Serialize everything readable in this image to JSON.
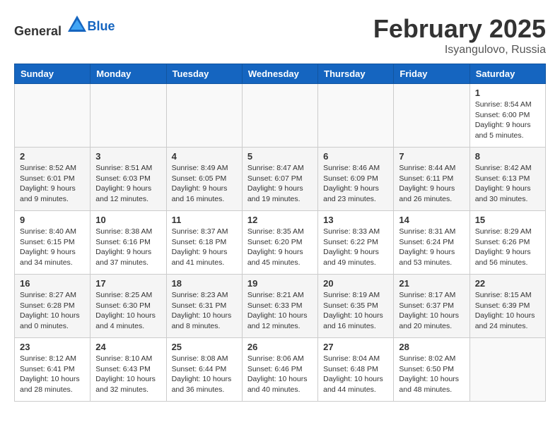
{
  "header": {
    "logo_general": "General",
    "logo_blue": "Blue",
    "month_year": "February 2025",
    "location": "Isyangulovo, Russia"
  },
  "weekdays": [
    "Sunday",
    "Monday",
    "Tuesday",
    "Wednesday",
    "Thursday",
    "Friday",
    "Saturday"
  ],
  "weeks": [
    [
      {
        "day": "",
        "info": ""
      },
      {
        "day": "",
        "info": ""
      },
      {
        "day": "",
        "info": ""
      },
      {
        "day": "",
        "info": ""
      },
      {
        "day": "",
        "info": ""
      },
      {
        "day": "",
        "info": ""
      },
      {
        "day": "1",
        "info": "Sunrise: 8:54 AM\nSunset: 6:00 PM\nDaylight: 9 hours and 5 minutes."
      }
    ],
    [
      {
        "day": "2",
        "info": "Sunrise: 8:52 AM\nSunset: 6:01 PM\nDaylight: 9 hours and 9 minutes."
      },
      {
        "day": "3",
        "info": "Sunrise: 8:51 AM\nSunset: 6:03 PM\nDaylight: 9 hours and 12 minutes."
      },
      {
        "day": "4",
        "info": "Sunrise: 8:49 AM\nSunset: 6:05 PM\nDaylight: 9 hours and 16 minutes."
      },
      {
        "day": "5",
        "info": "Sunrise: 8:47 AM\nSunset: 6:07 PM\nDaylight: 9 hours and 19 minutes."
      },
      {
        "day": "6",
        "info": "Sunrise: 8:46 AM\nSunset: 6:09 PM\nDaylight: 9 hours and 23 minutes."
      },
      {
        "day": "7",
        "info": "Sunrise: 8:44 AM\nSunset: 6:11 PM\nDaylight: 9 hours and 26 minutes."
      },
      {
        "day": "8",
        "info": "Sunrise: 8:42 AM\nSunset: 6:13 PM\nDaylight: 9 hours and 30 minutes."
      }
    ],
    [
      {
        "day": "9",
        "info": "Sunrise: 8:40 AM\nSunset: 6:15 PM\nDaylight: 9 hours and 34 minutes."
      },
      {
        "day": "10",
        "info": "Sunrise: 8:38 AM\nSunset: 6:16 PM\nDaylight: 9 hours and 37 minutes."
      },
      {
        "day": "11",
        "info": "Sunrise: 8:37 AM\nSunset: 6:18 PM\nDaylight: 9 hours and 41 minutes."
      },
      {
        "day": "12",
        "info": "Sunrise: 8:35 AM\nSunset: 6:20 PM\nDaylight: 9 hours and 45 minutes."
      },
      {
        "day": "13",
        "info": "Sunrise: 8:33 AM\nSunset: 6:22 PM\nDaylight: 9 hours and 49 minutes."
      },
      {
        "day": "14",
        "info": "Sunrise: 8:31 AM\nSunset: 6:24 PM\nDaylight: 9 hours and 53 minutes."
      },
      {
        "day": "15",
        "info": "Sunrise: 8:29 AM\nSunset: 6:26 PM\nDaylight: 9 hours and 56 minutes."
      }
    ],
    [
      {
        "day": "16",
        "info": "Sunrise: 8:27 AM\nSunset: 6:28 PM\nDaylight: 10 hours and 0 minutes."
      },
      {
        "day": "17",
        "info": "Sunrise: 8:25 AM\nSunset: 6:30 PM\nDaylight: 10 hours and 4 minutes."
      },
      {
        "day": "18",
        "info": "Sunrise: 8:23 AM\nSunset: 6:31 PM\nDaylight: 10 hours and 8 minutes."
      },
      {
        "day": "19",
        "info": "Sunrise: 8:21 AM\nSunset: 6:33 PM\nDaylight: 10 hours and 12 minutes."
      },
      {
        "day": "20",
        "info": "Sunrise: 8:19 AM\nSunset: 6:35 PM\nDaylight: 10 hours and 16 minutes."
      },
      {
        "day": "21",
        "info": "Sunrise: 8:17 AM\nSunset: 6:37 PM\nDaylight: 10 hours and 20 minutes."
      },
      {
        "day": "22",
        "info": "Sunrise: 8:15 AM\nSunset: 6:39 PM\nDaylight: 10 hours and 24 minutes."
      }
    ],
    [
      {
        "day": "23",
        "info": "Sunrise: 8:12 AM\nSunset: 6:41 PM\nDaylight: 10 hours and 28 minutes."
      },
      {
        "day": "24",
        "info": "Sunrise: 8:10 AM\nSunset: 6:43 PM\nDaylight: 10 hours and 32 minutes."
      },
      {
        "day": "25",
        "info": "Sunrise: 8:08 AM\nSunset: 6:44 PM\nDaylight: 10 hours and 36 minutes."
      },
      {
        "day": "26",
        "info": "Sunrise: 8:06 AM\nSunset: 6:46 PM\nDaylight: 10 hours and 40 minutes."
      },
      {
        "day": "27",
        "info": "Sunrise: 8:04 AM\nSunset: 6:48 PM\nDaylight: 10 hours and 44 minutes."
      },
      {
        "day": "28",
        "info": "Sunrise: 8:02 AM\nSunset: 6:50 PM\nDaylight: 10 hours and 48 minutes."
      },
      {
        "day": "",
        "info": ""
      }
    ]
  ]
}
